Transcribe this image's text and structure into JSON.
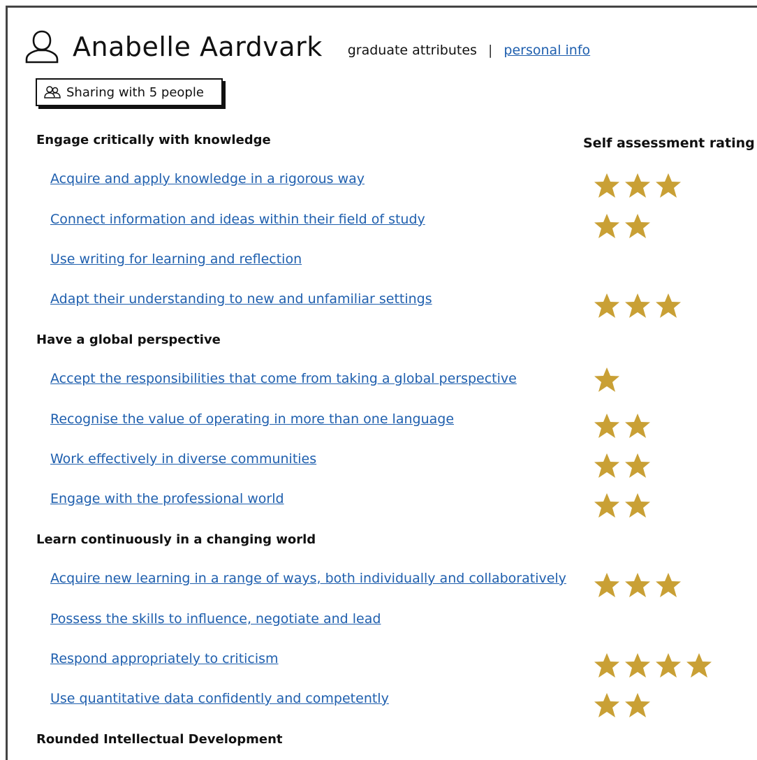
{
  "profile": {
    "name": "Anabelle Aardvark",
    "nav_current": "graduate attributes",
    "nav_separator": "|",
    "nav_link": "personal info"
  },
  "share_button": {
    "label": "Sharing with 5 people"
  },
  "rating_header": "Self assessment rating",
  "star_color": "#c9a035",
  "link_color": "#1f5fae",
  "sections": [
    {
      "title": "Engage critically with knowledge",
      "items": [
        {
          "label": "Acquire and apply knowledge in a rigorous way",
          "rating": 3
        },
        {
          "label": "Connect information and ideas within their field of study",
          "rating": 2
        },
        {
          "label": "Use writing for learning and reflection",
          "rating": 0
        },
        {
          "label": "Adapt their understanding to new and unfamiliar settings",
          "rating": 3
        }
      ]
    },
    {
      "title": "Have a global perspective",
      "items": [
        {
          "label": "Accept the responsibilities that come from taking a global perspective",
          "rating": 1
        },
        {
          "label": "Recognise the value of operating in more than one language",
          "rating": 2
        },
        {
          "label": "Work effectively in diverse communities",
          "rating": 2
        },
        {
          "label": "Engage with the professional world",
          "rating": 2
        }
      ]
    },
    {
      "title": "Learn continuously in a changing world",
      "items": [
        {
          "label": "Acquire new learning in a range of ways, both individually and collaboratively",
          "rating": 3
        },
        {
          "label": "Possess the skills to influence, negotiate and lead",
          "rating": 0
        },
        {
          "label": "Respond appropriately to criticism",
          "rating": 4
        },
        {
          "label": "Use quantitative data confidently and competently",
          "rating": 2
        }
      ]
    },
    {
      "title": "Rounded Intellectual Development",
      "items": []
    }
  ]
}
